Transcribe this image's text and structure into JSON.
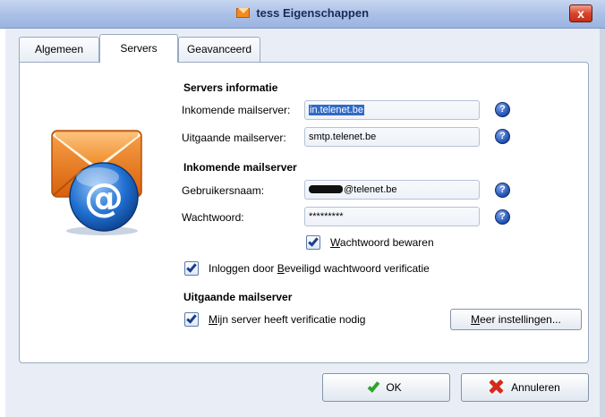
{
  "window": {
    "title": "tess Eigenschappen",
    "close_label": "x"
  },
  "tabs": [
    {
      "label": "Algemeen",
      "active": false
    },
    {
      "label": "Servers",
      "active": true
    },
    {
      "label": "Geavanceerd",
      "active": false
    }
  ],
  "servers_info": {
    "heading": "Servers informatie",
    "incoming_label": "Inkomende mailserver:",
    "incoming_value": "in.telenet.be",
    "outgoing_label": "Uitgaande mailserver:",
    "outgoing_value": "smtp.telenet.be"
  },
  "incoming_server": {
    "heading": "Inkomende mailserver",
    "username_label": "Gebruikersnaam:",
    "username_value": "@telenet.be",
    "password_label": "Wachtwoord:",
    "password_value": "*********",
    "remember_first": "W",
    "remember_rest": "achtwoord bewaren",
    "remember_checked": true,
    "spa_text_a": "Inloggen door ",
    "spa_text_u": "B",
    "spa_text_b": "eveiligd wachtwoord verificatie",
    "spa_checked": true
  },
  "outgoing_server": {
    "heading": "Uitgaande mailserver",
    "auth_first": "M",
    "auth_rest": "ijn server heeft verificatie nodig",
    "auth_checked": true,
    "more_first": "M",
    "more_rest": "eer instellingen..."
  },
  "buttons": {
    "ok": "OK",
    "cancel": "Annuleren"
  },
  "help_glyph": "?",
  "icons": [
    "mail-at-icon",
    "help-icon",
    "checkmark-icon",
    "cancel-x-icon"
  ],
  "colors": {
    "selection": "#316ac5",
    "help_blue": "#1f4fb4",
    "envelope_orange": "#f28a1c",
    "ok_green": "#2fa52a",
    "cancel_red": "#d42a1c"
  }
}
